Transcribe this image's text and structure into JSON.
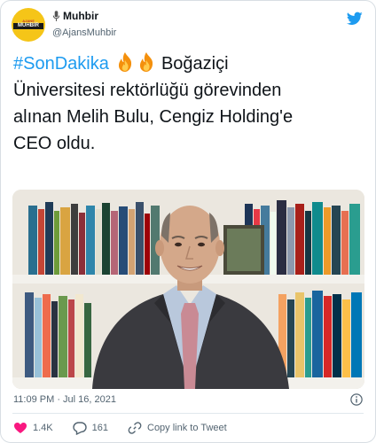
{
  "account": {
    "display_name": "Muhbir",
    "handle": "@AjansMuhbir",
    "avatar_top": "AJANS",
    "avatar_main": "MUHBİR"
  },
  "tweet": {
    "hashtag": "#SonDakika",
    "text_line1": "Boğaziçi",
    "text_line2": "Üniversitesi rektörlüğü görevinden",
    "text_line3": "alınan Melih Bulu, Cengiz Holding'e",
    "text_line4": "CEO oldu."
  },
  "meta": {
    "timestamp": "11:09 PM · Jul 16, 2021"
  },
  "actions": {
    "likes": "1.4K",
    "replies": "161",
    "copy_link": "Copy link to Tweet"
  },
  "colors": {
    "accent": "#1d9bf0",
    "heart": "#f91880",
    "text": "#0f1419",
    "muted": "#536471"
  },
  "icons": [
    "microphone-icon",
    "twitter-bird-icon",
    "fire-emoji-icon",
    "info-icon",
    "heart-icon",
    "reply-icon",
    "link-icon"
  ]
}
